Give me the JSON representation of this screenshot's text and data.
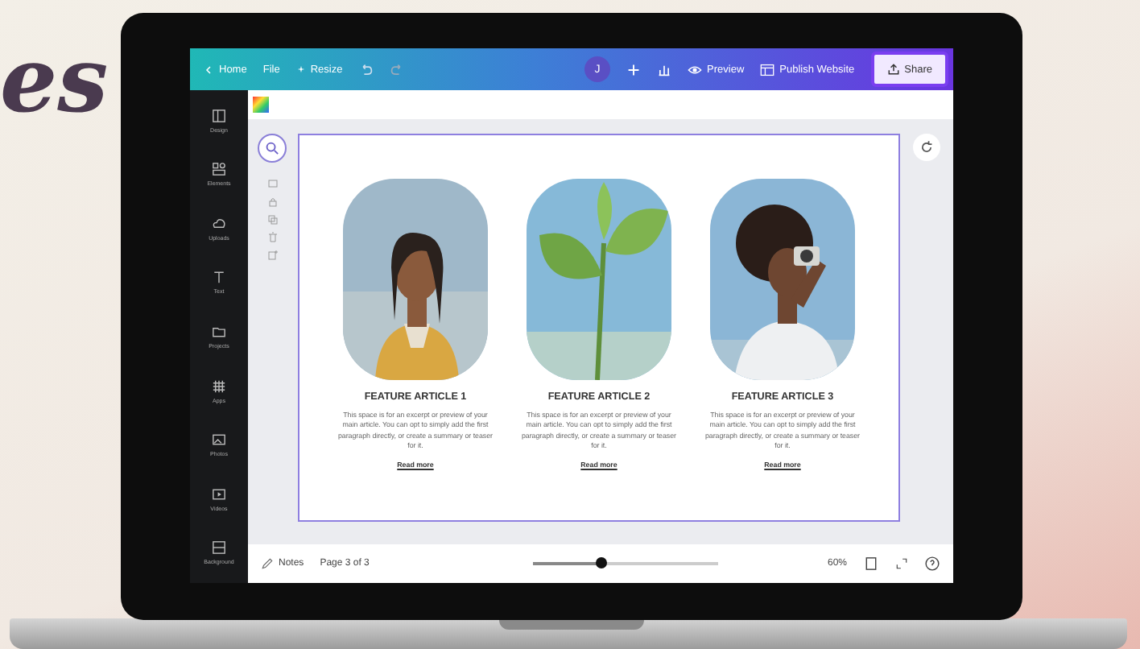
{
  "backdrop_text": "es",
  "topbar": {
    "home": "Home",
    "file": "File",
    "resize": "Resize",
    "avatar": "J",
    "preview": "Preview",
    "publish": "Publish Website",
    "share": "Share"
  },
  "sidebar": {
    "items": [
      {
        "label": "Design"
      },
      {
        "label": "Elements"
      },
      {
        "label": "Uploads"
      },
      {
        "label": "Text"
      },
      {
        "label": "Projects"
      },
      {
        "label": "Apps"
      },
      {
        "label": "Photos"
      },
      {
        "label": "Videos"
      },
      {
        "label": "Background"
      }
    ]
  },
  "articles": [
    {
      "title": "FEATURE ARTICLE 1",
      "body": "This space is for an excerpt or preview of your main article. You can opt to simply add the first paragraph directly, or create a summary or teaser for it.",
      "link": "Read more",
      "kind": "picture"
    },
    {
      "title": "FEATURE ARTICLE 2",
      "body": "This space is for an excerpt or preview of your main article. You can opt to simply add the first paragraph directly, or create a summary or teaser for it.",
      "link": "Read more",
      "kind": "picture"
    },
    {
      "title": "FEATURE ARTICLE 3",
      "body": "This space is for an excerpt or preview of your main article. You can opt to simply add the first paragraph directly, or create a summary or teaser for it.",
      "link": "Read more",
      "kind": "picture"
    }
  ],
  "bottombar": {
    "notes": "Notes",
    "page": "Page 3 of 3",
    "zoom": {
      "level": 0.37
    },
    "zoom_reading": "60%"
  }
}
